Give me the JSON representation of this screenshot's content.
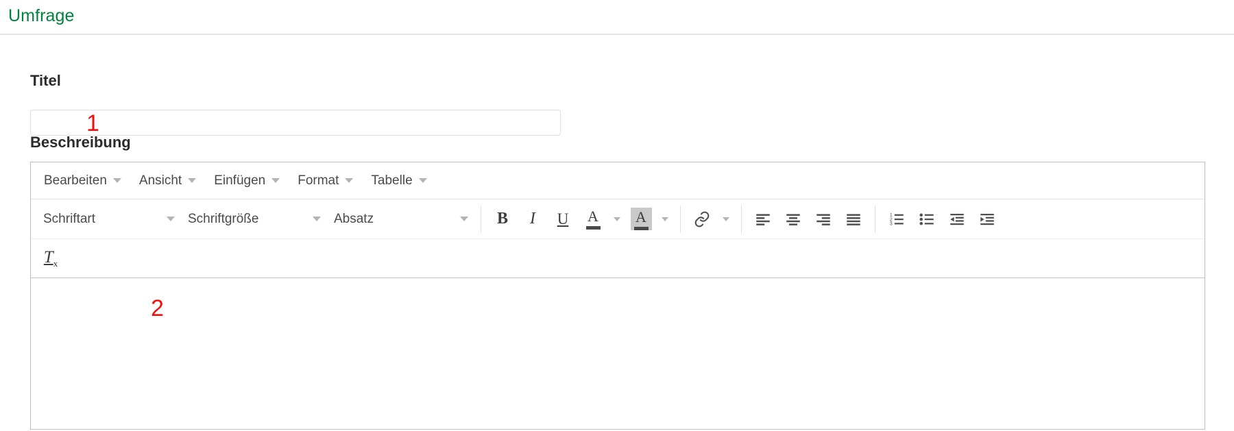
{
  "header": {
    "title": "Umfrage"
  },
  "form": {
    "title_label": "Titel",
    "title_input_value": "",
    "title_input_placeholder": "",
    "description_label": "Beschreibung"
  },
  "annotations": [
    {
      "id": "marker-1",
      "label": "1",
      "color": "#ee1111",
      "target": "title-input"
    },
    {
      "id": "marker-2",
      "label": "2",
      "color": "#ee1111",
      "target": "description-editor-body"
    }
  ],
  "editor": {
    "menubar": [
      {
        "label": "Bearbeiten",
        "icon": "chevron-down-icon"
      },
      {
        "label": "Ansicht",
        "icon": "chevron-down-icon"
      },
      {
        "label": "Einfügen",
        "icon": "chevron-down-icon"
      },
      {
        "label": "Format",
        "icon": "chevron-down-icon"
      },
      {
        "label": "Tabelle",
        "icon": "chevron-down-icon"
      }
    ],
    "selects": {
      "fontfamily": "Schriftart",
      "fontsize": "Schriftgröße",
      "blockformat": "Absatz"
    },
    "buttons": {
      "bold": "B",
      "italic": "I",
      "underline": "U",
      "forecolor": "A",
      "backcolor": "A",
      "removeformat": "T"
    },
    "icon_names": {
      "bold": "bold-icon",
      "italic": "italic-icon",
      "underline": "underline-icon",
      "forecolor": "text-color-icon",
      "backcolor": "background-color-icon",
      "link": "link-icon",
      "align_left": "align-left-icon",
      "align_center": "align-center-icon",
      "align_right": "align-right-icon",
      "align_justify": "align-justify-icon",
      "numlist": "numbered-list-icon",
      "bullist": "bullet-list-icon",
      "outdent": "decrease-indent-icon",
      "indent": "increase-indent-icon",
      "removeformat": "remove-formatting-icon"
    },
    "content": "",
    "backcolor_swatch": "#c9c9c9"
  },
  "theme": {
    "accent_green": "#00833e",
    "border_gray": "#bfbfbf",
    "divider_gray": "#e3e3e3",
    "text_gray": "#4a4a4a",
    "icon_gray": "#4f4f4f",
    "annotation_red": "#ee1111"
  }
}
